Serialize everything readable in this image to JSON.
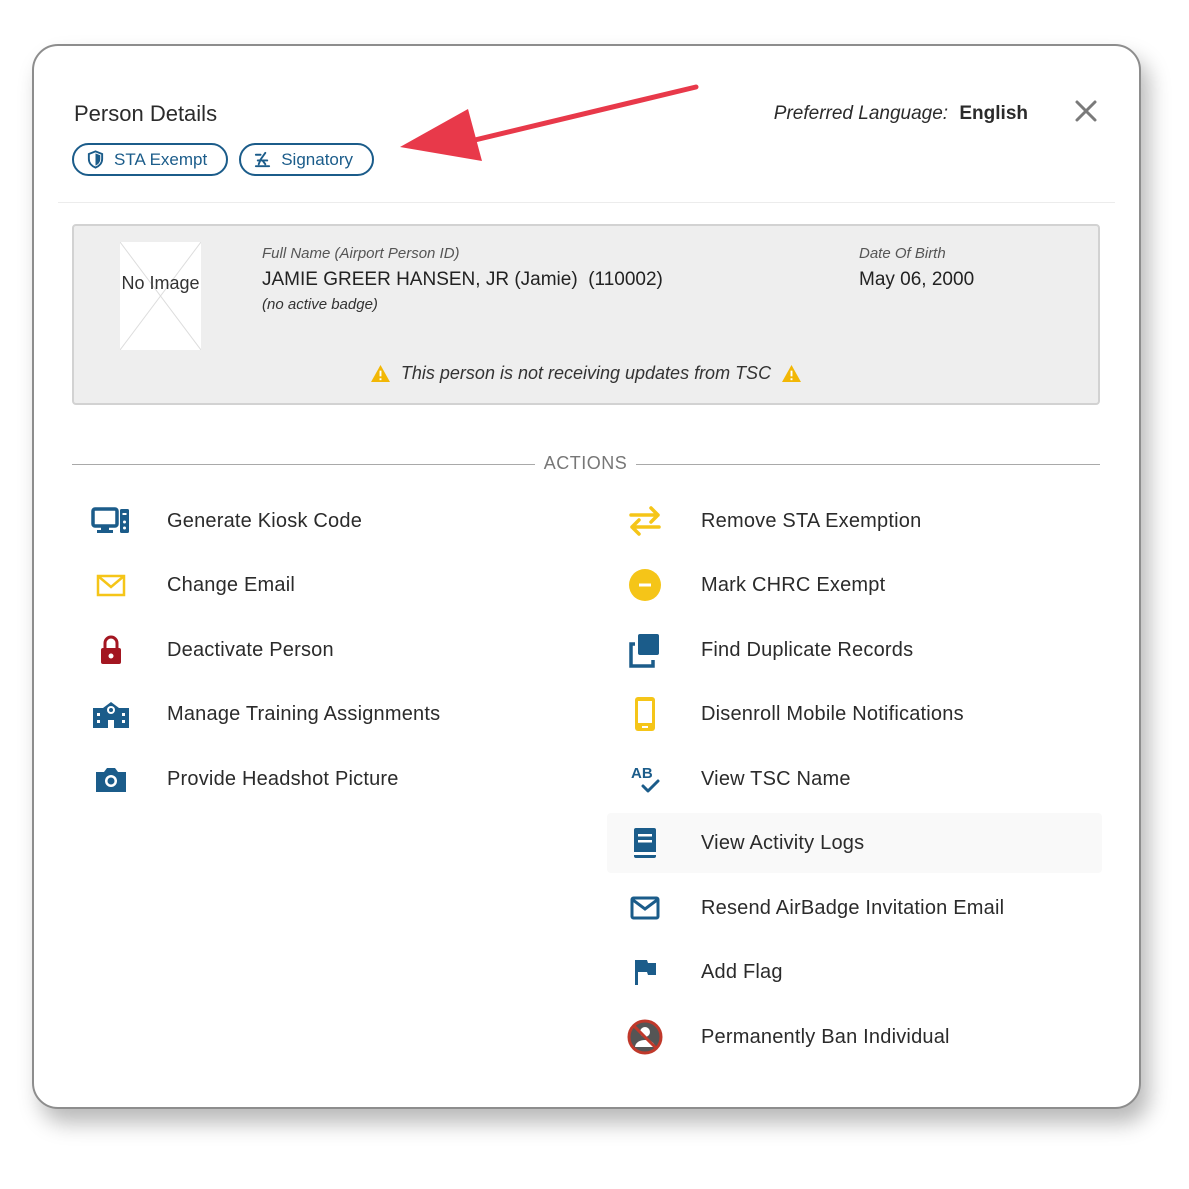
{
  "header": {
    "title": "Person Details",
    "pills": [
      {
        "label": "STA Exempt",
        "icon": "shield-icon"
      },
      {
        "label": "Signatory",
        "icon": "signature-icon"
      }
    ],
    "preferred_language_label": "Preferred Language:",
    "preferred_language_value": "English",
    "close_icon": "close-icon"
  },
  "person": {
    "photo_text": "No Image",
    "full_name_label": "Full Name (Airport Person ID)",
    "full_name_value": "JAMIE GREER HANSEN, JR (Jamie)  (110002)",
    "badge_note": "(no active badge)",
    "dob_label": "Date Of Birth",
    "dob_value": "May 06, 2000",
    "warning_text": "This person is not receiving updates from TSC"
  },
  "actions": {
    "heading": "ACTIONS",
    "left": [
      {
        "label": "Generate Kiosk Code",
        "icon": "kiosk-icon",
        "color": "#1b5c8a"
      },
      {
        "label": "Change Email",
        "icon": "envelope-icon",
        "color": "#f5c518"
      },
      {
        "label": "Deactivate Person",
        "icon": "lock-icon",
        "color": "#a31621"
      },
      {
        "label": "Manage Training Assignments",
        "icon": "school-icon",
        "color": "#1b5c8a"
      },
      {
        "label": "Provide Headshot Picture",
        "icon": "camera-icon",
        "color": "#1b5c8a"
      }
    ],
    "right": [
      {
        "label": "Remove STA Exemption",
        "icon": "swap-arrows-icon",
        "color": "#f5c518"
      },
      {
        "label": "Mark CHRC Exempt",
        "icon": "minus-circle-icon",
        "color": "#f5c518"
      },
      {
        "label": "Find Duplicate Records",
        "icon": "duplicate-icon",
        "color": "#1b5c8a"
      },
      {
        "label": "Disenroll Mobile Notifications",
        "icon": "mobile-icon",
        "color": "#f5c518"
      },
      {
        "label": "View TSC Name",
        "icon": "spellcheck-icon",
        "color": "#1b5c8a"
      },
      {
        "label": "View Activity Logs",
        "icon": "book-icon",
        "color": "#1b5c8a"
      },
      {
        "label": "Resend AirBadge Invitation Email",
        "icon": "envelope-outline-icon",
        "color": "#1b5c8a"
      },
      {
        "label": "Add Flag",
        "icon": "flag-icon",
        "color": "#1b5c8a"
      },
      {
        "label": "Permanently Ban Individual",
        "icon": "ban-person-icon",
        "color": "#c0392b"
      }
    ]
  },
  "annotation": {
    "icon": "red-arrow-icon",
    "color": "#e8394a"
  }
}
